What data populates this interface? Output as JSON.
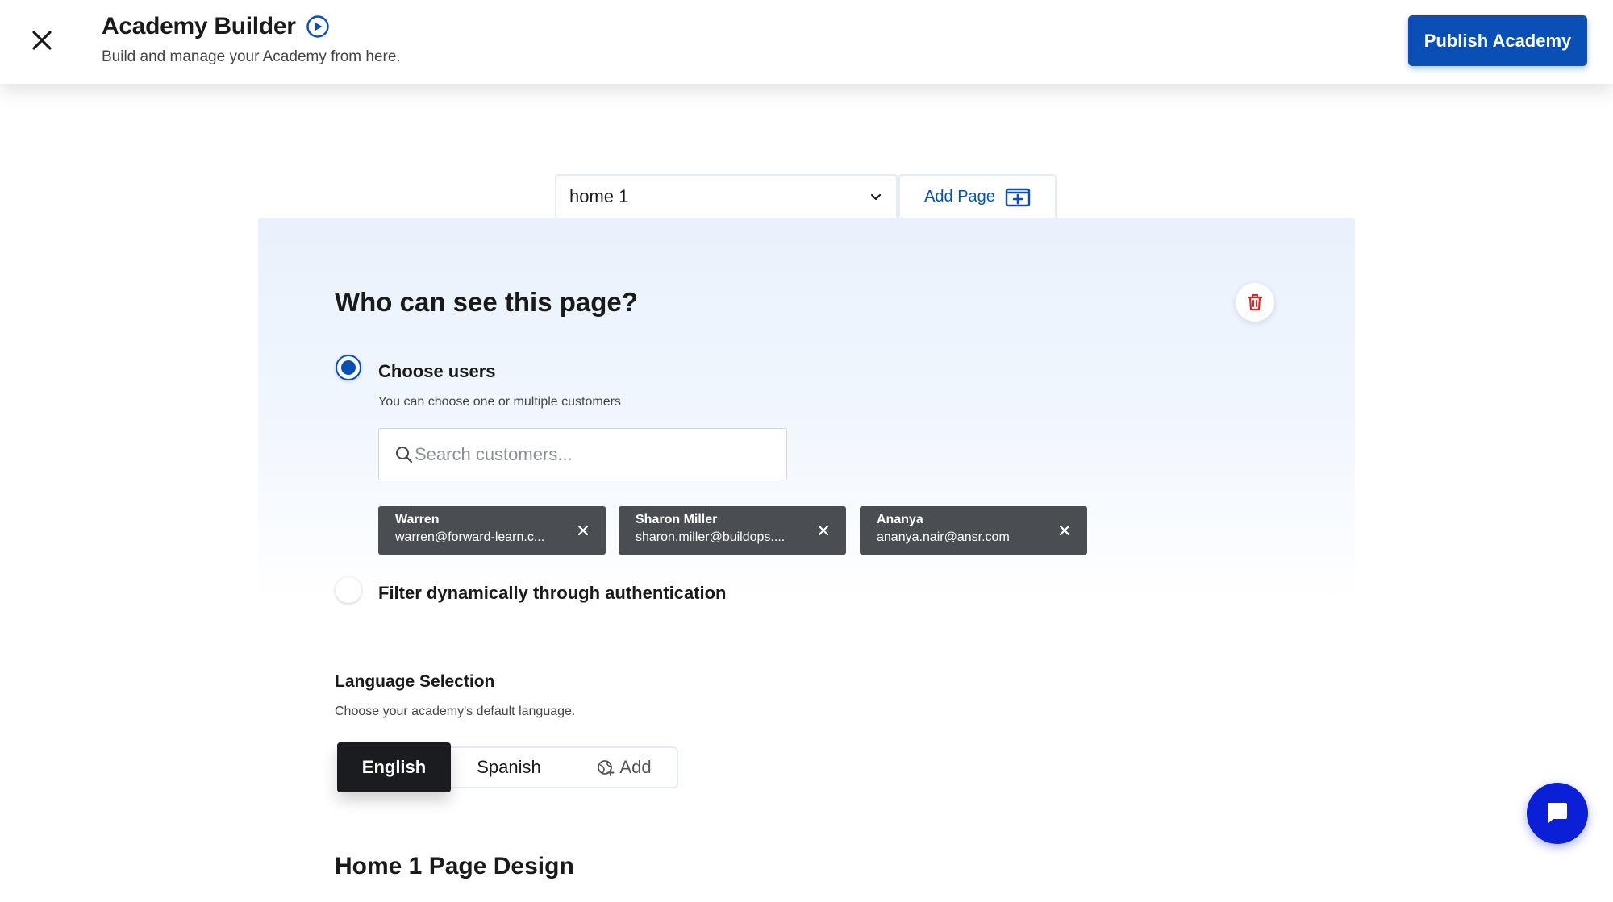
{
  "header": {
    "title": "Academy Builder",
    "subtitle": "Build and manage your Academy from here.",
    "publish_label": "Publish Academy",
    "close_icon": "close-icon",
    "play_icon": "play-circle-icon"
  },
  "page_tabs": {
    "selected_page": "home 1",
    "add_page_label": "Add Page"
  },
  "visibility": {
    "heading": "Who can see this page?",
    "option_choose_users": {
      "label": "Choose users",
      "hint": "You can choose one or multiple customers",
      "selected": true
    },
    "search": {
      "placeholder": "Search customers...",
      "value": ""
    },
    "chips": [
      {
        "name": "Warren",
        "email": "warren@forward-learn.c..."
      },
      {
        "name": "Sharon Miller",
        "email": "sharon.miller@buildops...."
      },
      {
        "name": "Ananya",
        "email": "ananya.nair@ansr.com"
      }
    ],
    "option_filter": {
      "label": "Filter dynamically through authentication",
      "selected": false
    }
  },
  "language": {
    "title": "Language Selection",
    "hint": "Choose your academy's default language.",
    "options": [
      "English",
      "Spanish"
    ],
    "selected": "English",
    "add_label": "Add"
  },
  "design": {
    "title": "Home 1 Page Design"
  },
  "colors": {
    "primary": "#0a4fb5",
    "chip_bg": "#4a4d52",
    "delete_red": "#d62828",
    "chat_blue": "#0a1fd6"
  }
}
